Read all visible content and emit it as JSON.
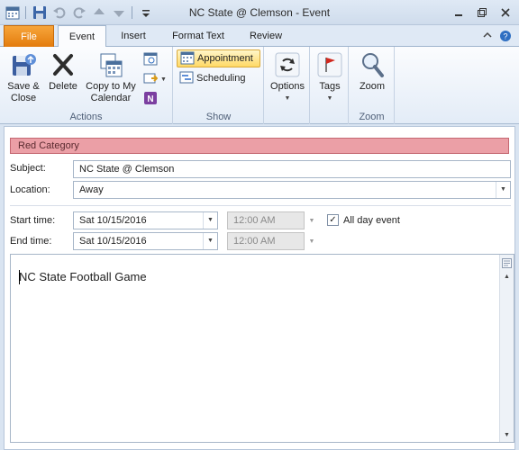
{
  "window": {
    "title": "NC State @ Clemson - Event",
    "buttons": {
      "minimize": "▭",
      "restore": "❐",
      "close": "✕"
    }
  },
  "tabs": [
    {
      "label": "File"
    },
    {
      "label": "Event"
    },
    {
      "label": "Insert"
    },
    {
      "label": "Format Text"
    },
    {
      "label": "Review"
    }
  ],
  "ribbon": {
    "actions": {
      "group_label": "Actions",
      "save_close": "Save &\nClose",
      "delete": "Delete",
      "copy_calendar": "Copy to My\nCalendar"
    },
    "show": {
      "group_label": "Show",
      "appointment": "Appointment",
      "scheduling": "Scheduling"
    },
    "options": {
      "label": "Options"
    },
    "tags": {
      "label": "Tags"
    },
    "zoom": {
      "group_label": "Zoom",
      "label": "Zoom"
    }
  },
  "form": {
    "category": "Red Category",
    "subject_label": "Subject:",
    "subject_value": "NC State @ Clemson",
    "location_label": "Location:",
    "location_value": "Away",
    "start_label": "Start time:",
    "start_date": "Sat 10/15/2016",
    "start_time": "12:00 AM",
    "end_label": "End time:",
    "end_date": "Sat 10/15/2016",
    "end_time": "12:00 AM",
    "all_day_label": "All day event",
    "all_day_checked": true,
    "body_text": "NC State Football Game"
  },
  "colors": {
    "category_fill": "#eb9fa6",
    "file_tab": "#e37c0e",
    "selected_button": "#ffd966"
  }
}
